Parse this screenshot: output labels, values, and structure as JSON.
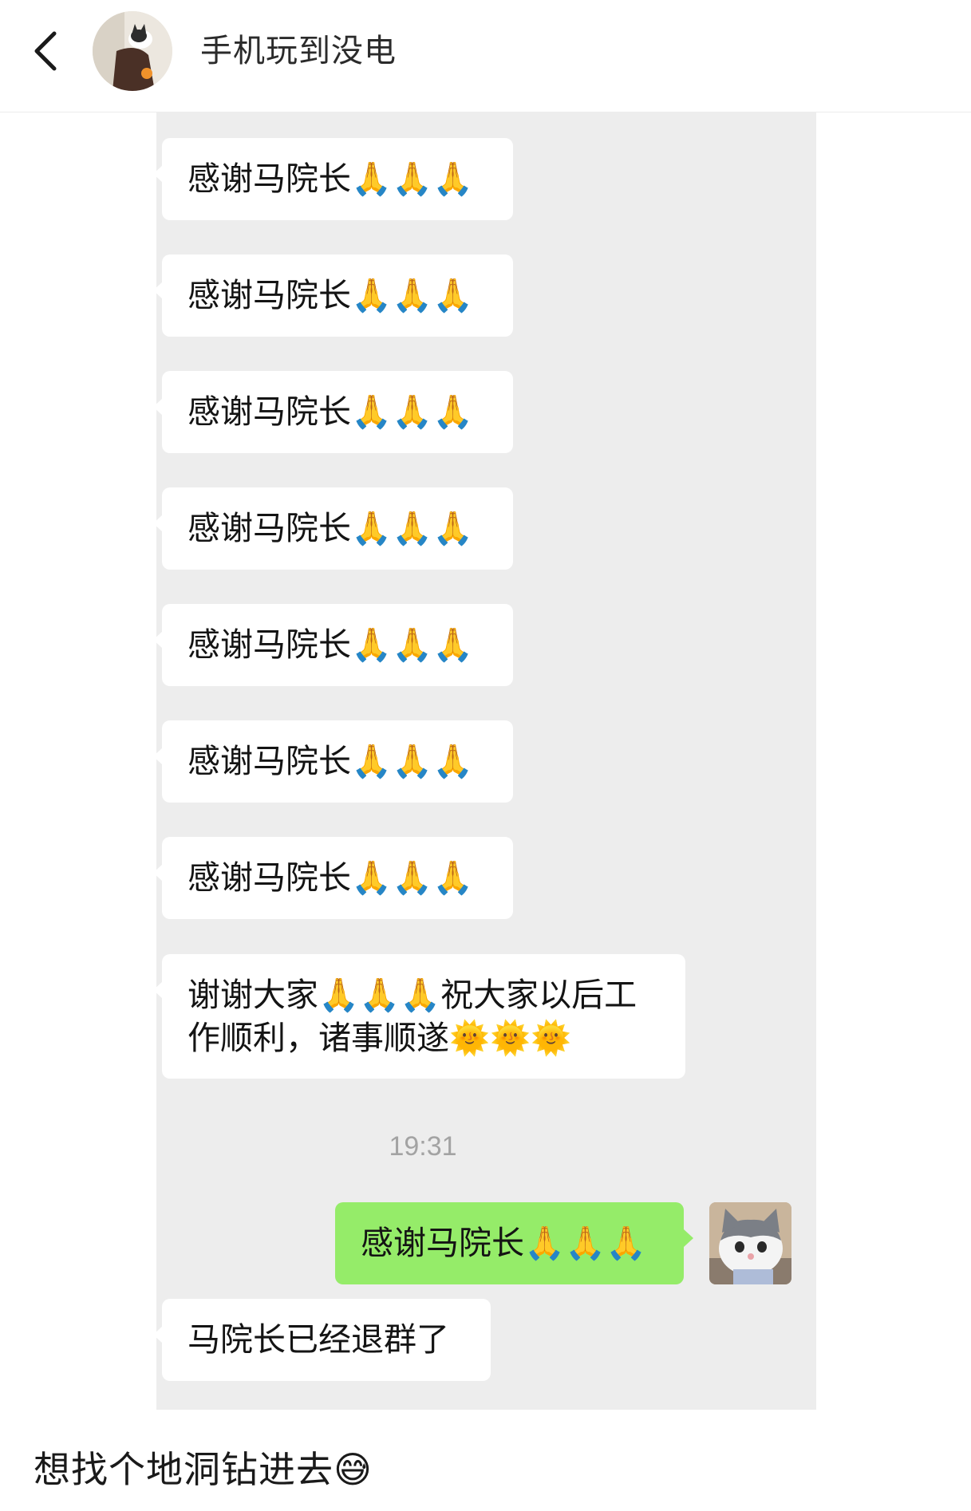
{
  "header": {
    "contact_name": "手机玩到没电"
  },
  "messages": {
    "m1": "感谢马院长🙏🙏🙏",
    "m2": "感谢马院长🙏🙏🙏",
    "m3": "感谢马院长🙏🙏🙏",
    "m4": "感谢马院长🙏🙏🙏",
    "m5": "感谢马院长🙏🙏🙏",
    "m6": "感谢马院长🙏🙏🙏",
    "m7": "感谢马院长🙏🙏🙏",
    "m8": "谢谢大家🙏🙏🙏祝大家以后工\n作顺利，诸事顺遂🌞🌞🌞",
    "timestamp": "19:31",
    "sent": "感谢马院长🙏🙏🙏",
    "last": "马院长已经退群了"
  },
  "caption": "想找个地洞钻进去😅",
  "icons": {
    "back": "chevron-left-icon",
    "contact_avatar": "cat-on-chair-avatar",
    "self_avatar": "grey-white-kitten-avatar"
  },
  "colors": {
    "chat_background": "#ededed",
    "incoming_bubble": "#ffffff",
    "outgoing_bubble": "#95ec69",
    "timestamp_text": "#a3a3a3"
  }
}
